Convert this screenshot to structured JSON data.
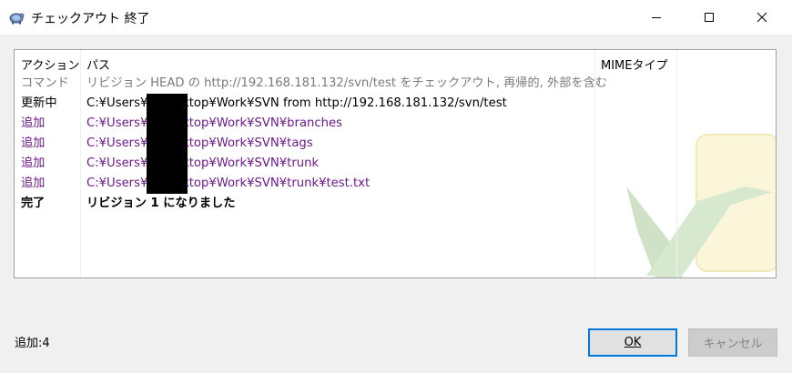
{
  "window": {
    "title": "チェックアウト 終了",
    "app_icon": "tortoisesvn-icon"
  },
  "list": {
    "columns": [
      "アクション",
      "パス",
      "MIMEタイプ"
    ],
    "rows": [
      {
        "action": "コマンド",
        "path": "リビジョン HEAD の http://192.168.181.132/svn/test をチェックアウト, 再帰的, 外部を含む",
        "style": "gray"
      },
      {
        "action": "更新中",
        "path": "C:¥Users¥        ¥Desktop¥Work¥SVN from http://192.168.181.132/svn/test",
        "style": "black"
      },
      {
        "action": "追加",
        "path": "C:¥Users¥        ¥Desktop¥Work¥SVN¥branches",
        "style": "purple"
      },
      {
        "action": "追加",
        "path": "C:¥Users¥        ¥Desktop¥Work¥SVN¥tags",
        "style": "purple"
      },
      {
        "action": "追加",
        "path": "C:¥Users¥        ¥Desktop¥Work¥SVN¥trunk",
        "style": "purple"
      },
      {
        "action": "追加",
        "path": "C:¥Users¥        ¥Desktop¥Work¥SVN¥trunk¥test.txt",
        "style": "purple"
      },
      {
        "action": "完了",
        "path": "リビジョン 1 になりました",
        "style": "bold"
      }
    ]
  },
  "status": "追加:4",
  "buttons": {
    "ok": "OK",
    "cancel": "キャンセル"
  },
  "colors": {
    "added": "#6e1a8a",
    "command": "#7a7a7a",
    "focus_border": "#0078d7"
  }
}
